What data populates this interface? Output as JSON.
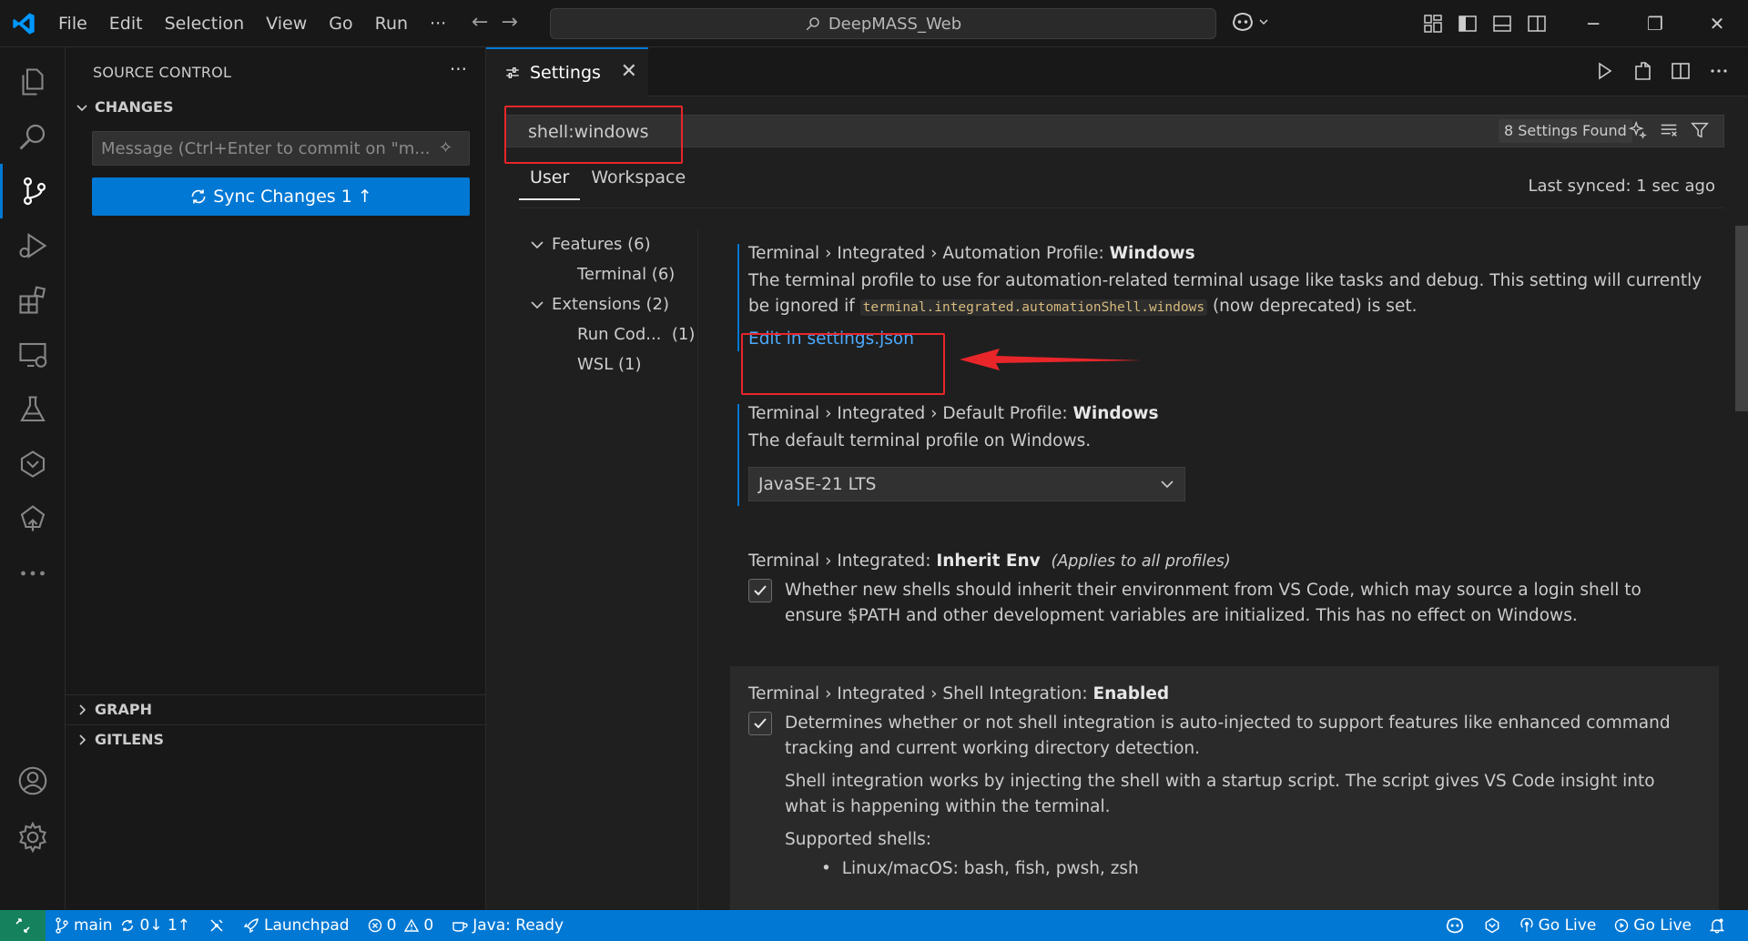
{
  "menu": [
    "File",
    "Edit",
    "Selection",
    "View",
    "Go",
    "Run",
    "···"
  ],
  "command_center": "DeepMASS_Web",
  "sidebar": {
    "title": "SOURCE CONTROL",
    "more": "···",
    "changes": "CHANGES",
    "commit_placeholder": "Message (Ctrl+Enter to commit on \"m...",
    "sync_label": "Sync Changes 1",
    "graph": "GRAPH",
    "gitlens": "GITLENS"
  },
  "editor": {
    "tab_label": "Settings",
    "search_value": "shell:windows",
    "found": "8 Settings Found",
    "scope_tabs": [
      "User",
      "Workspace"
    ],
    "last_synced": "Last synced: 1 sec ago"
  },
  "toc": [
    {
      "label": "Features (6)",
      "indent": 0,
      "expanded": true
    },
    {
      "label": "Terminal (6)",
      "indent": 1
    },
    {
      "label": "Extensions (2)",
      "indent": 0,
      "expanded": true
    },
    {
      "label": "Run Cod...  (1)",
      "indent": 1
    },
    {
      "label": "WSL (1)",
      "indent": 1
    }
  ],
  "settings": {
    "automation": {
      "prefix": "Terminal › Integrated › Automation Profile: ",
      "name": "Windows",
      "desc_a": "The terminal profile to use for automation-related terminal usage like tasks and debug. This setting will currently be ignored if ",
      "code": "terminal.integrated.automationShell.windows",
      "desc_b": " (now deprecated) is set.",
      "link": "Edit in settings.json"
    },
    "default_profile": {
      "prefix": "Terminal › Integrated › Default Profile: ",
      "name": "Windows",
      "desc": "The default terminal profile on Windows.",
      "value": "JavaSE-21 LTS"
    },
    "inherit_env": {
      "prefix": "Terminal › Integrated: ",
      "name": "Inherit Env",
      "note": "(Applies to all profiles)",
      "desc": "Whether new shells should inherit their environment from VS Code, which may source a login shell to ensure $PATH and other development variables are initialized. This has no effect on Windows."
    },
    "shell_integration": {
      "prefix": "Terminal › Integrated › Shell Integration: ",
      "name": "Enabled",
      "desc": "Determines whether or not shell integration is auto-injected to support features like enhanced command tracking and current working directory detection.",
      "desc2": "Shell integration works by injecting the shell with a startup script. The script gives VS Code insight into what is happening within the terminal.",
      "supported": "Supported shells:",
      "bullet1": "Linux/macOS: bash, fish, pwsh, zsh"
    }
  },
  "statusbar": {
    "branch": "main",
    "sync": "0↓ 1↑",
    "launchpad": "Launchpad",
    "errors": "0",
    "warnings": "0",
    "java": "Java: Ready",
    "golive1": "Go Live",
    "golive2": "Go Live"
  },
  "colors": {
    "accent": "#0078d4",
    "highlight": "#e8262a",
    "link": "#4daafc",
    "remote": "#16825d"
  }
}
